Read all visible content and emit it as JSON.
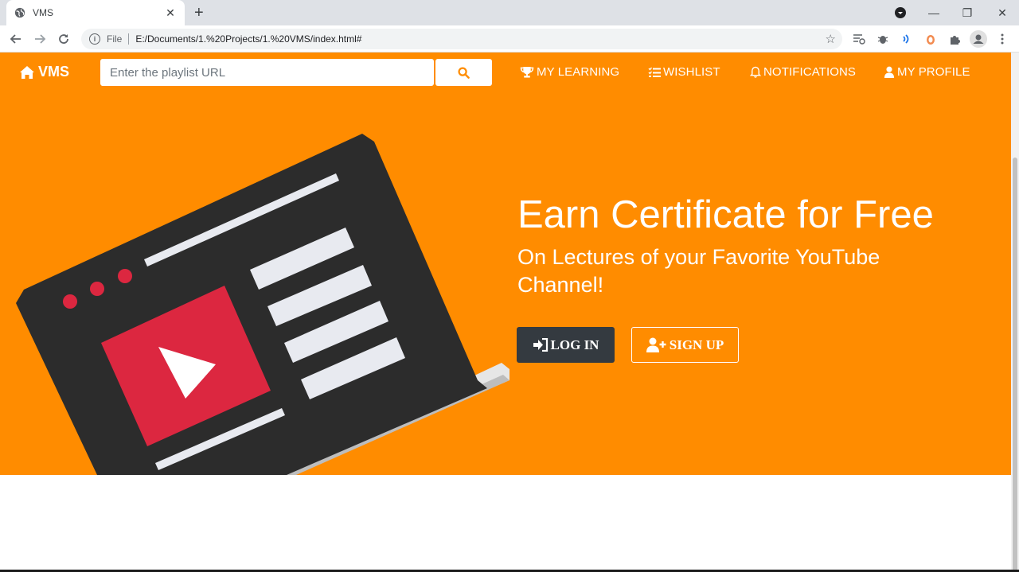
{
  "browser": {
    "tab_title": "VMS",
    "tab_close": "✕",
    "new_tab": "+",
    "address_scheme_label": "File",
    "address_url": "E:/Documents/1.%20Projects/1.%20VMS/index.html#",
    "window_minimize": "—",
    "window_restore": "❐",
    "window_close": "✕"
  },
  "navbar": {
    "brand": "VMS",
    "search_placeholder": "Enter the playlist URL",
    "links": [
      {
        "label": "MY LEARNING",
        "icon": "trophy-icon"
      },
      {
        "label": "WISHLIST",
        "icon": "list-check-icon"
      },
      {
        "label": "NOTIFICATIONS",
        "icon": "bell-icon"
      },
      {
        "label": "MY PROFILE",
        "icon": "user-icon"
      }
    ]
  },
  "hero": {
    "headline": "Earn Certificate for Free",
    "subheadline": "On Lectures of your Favorite YouTube Channel!",
    "login_label": "LOG IN",
    "signup_label": "SIGN UP"
  },
  "colors": {
    "hero_bg": "#ff8c00",
    "login_bg": "#343a40",
    "laptop_body": "#2d2d2d",
    "video_red": "#dc2740",
    "content_bars": "#e8eaf0"
  }
}
